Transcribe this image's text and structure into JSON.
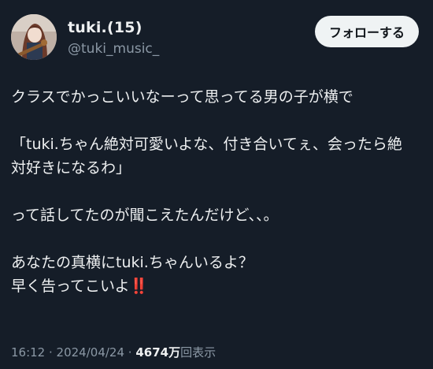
{
  "user": {
    "display_name": "tuki.(15)",
    "handle": "@tuki_music_"
  },
  "follow_button": {
    "label": "フォローする"
  },
  "post": {
    "line1": "クラスでかっこいいなーって思ってる男の子が横で",
    "line2": "「tuki.ちゃん絶対可愛いよな、付き合いてぇ、会ったら絶",
    "line3": "対好きになるわ」",
    "line4": "って話してたのが聞こえたんだけど、、。",
    "line5": "あなたの真横にtuki.ちゃんいるよ？",
    "line6": "早く告ってこいよ",
    "emphasis": "‼️"
  },
  "meta": {
    "time": "16:12",
    "sep1": " · ",
    "date": "2024/04/24",
    "sep2": " · ",
    "views_count": "4674万",
    "views_label": "回表示"
  },
  "colors": {
    "background": "#151d28",
    "text": "#e7e9ea",
    "secondary_text": "#8b98a5",
    "follow_bg": "#eff3f4"
  }
}
